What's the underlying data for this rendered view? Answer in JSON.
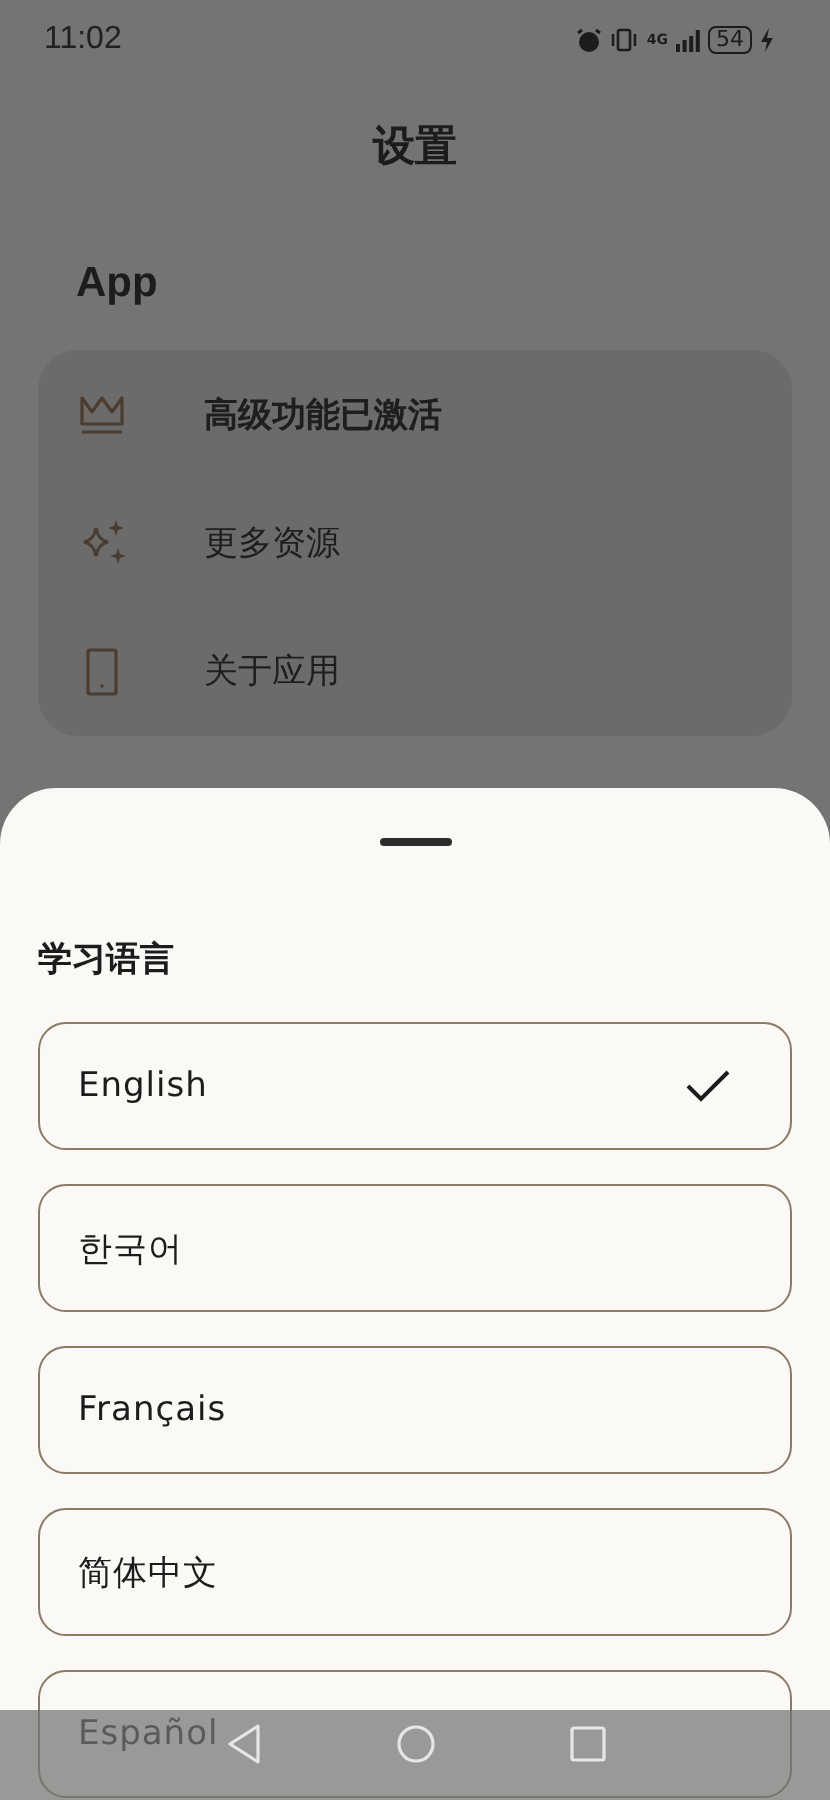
{
  "status_bar": {
    "time": "11:02",
    "network": "4G",
    "battery": "54"
  },
  "header": {
    "title": "设置"
  },
  "section": {
    "title": "App",
    "items": [
      {
        "label": "高级功能已激活",
        "emphasized": true
      },
      {
        "label": "更多资源",
        "emphasized": false
      },
      {
        "label": "关于应用",
        "emphasized": false
      }
    ]
  },
  "sheet": {
    "title": "学习语言",
    "options": [
      {
        "label": "English",
        "selected": true
      },
      {
        "label": "한국어",
        "selected": false
      },
      {
        "label": "Français",
        "selected": false
      },
      {
        "label": "简体中文",
        "selected": false
      },
      {
        "label": "Español",
        "selected": false
      }
    ]
  }
}
